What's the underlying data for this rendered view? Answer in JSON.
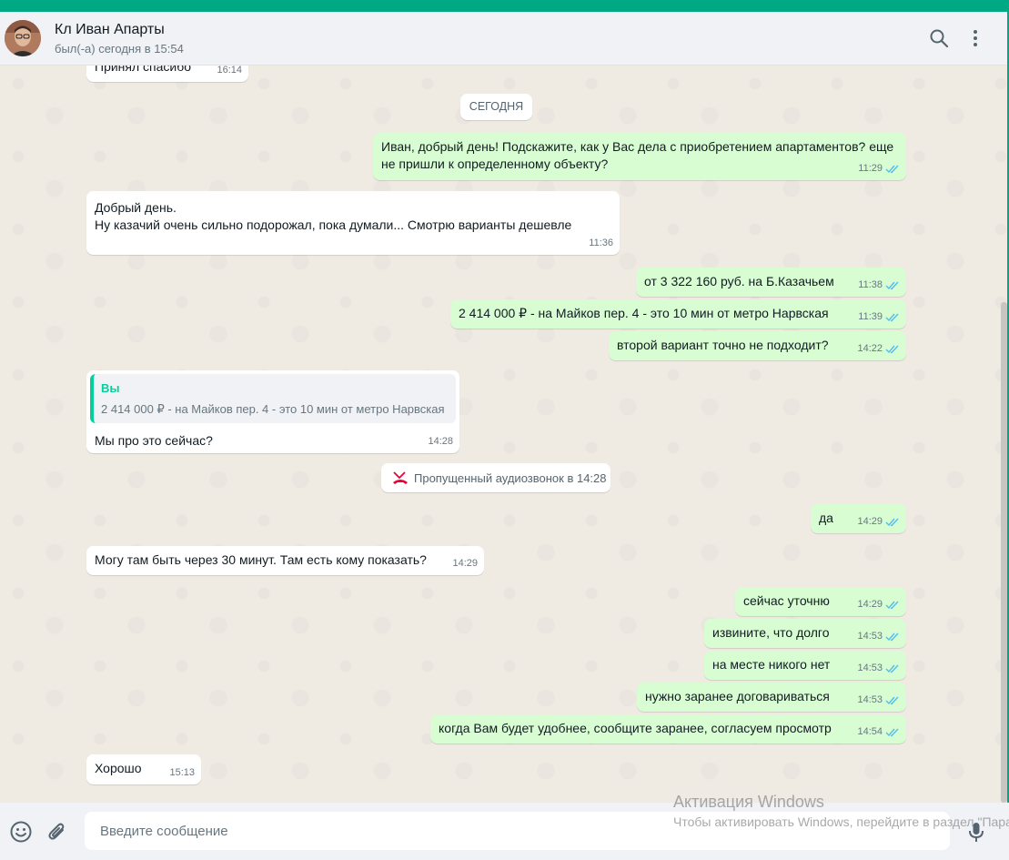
{
  "header": {
    "contact_name": "Кл Иван Апарты",
    "status": "был(-а) сегодня в 15:54"
  },
  "colors": {
    "accent": "#00a884",
    "outgoing_bubble": "#d9fdd3",
    "incoming_bubble": "#ffffff",
    "read_ticks": "#53bdeb",
    "missed_call": "#ea0038"
  },
  "chat": {
    "partial_message": {
      "text": "Принял спасибо",
      "time": "16:14"
    },
    "day_label": "СЕГОДНЯ",
    "messages": [
      {
        "dir": "out",
        "text": "Иван, добрый день! Подскажите, как у Вас дела с приобретением апартаментов? еще\nне пришли к определенному объекту?",
        "time": "11:29"
      },
      {
        "dir": "in",
        "text": "Добрый день.\nНу казачий очень сильно подорожал, пока думали... Смотрю варианты дешевле",
        "time": "11:36"
      },
      {
        "dir": "out",
        "text": "от 3 322 160 руб. на Б.Казачьем",
        "time": "11:38"
      },
      {
        "dir": "out",
        "text": "2 414 000 ₽ - на Майков пер. 4 - это 10 мин от метро Нарвская",
        "time": "11:39"
      },
      {
        "dir": "out",
        "text": "второй вариант точно не подходит?",
        "time": "14:22"
      },
      {
        "dir": "in",
        "quote_author": "Вы",
        "quote_text": "2 414 000 ₽ - на Майков пер. 4 - это 10 мин от метро Нарвская",
        "text": "Мы про это сейчас?",
        "time": "14:28"
      },
      {
        "dir": "out",
        "text": "да",
        "time": "14:29"
      },
      {
        "dir": "in",
        "text": "Могу там быть через 30 минут. Там есть кому показать?",
        "time": "14:29"
      },
      {
        "dir": "out",
        "text": "сейчас уточню",
        "time": "14:29"
      },
      {
        "dir": "out",
        "text": "извините, что долго",
        "time": "14:53"
      },
      {
        "dir": "out",
        "text": "на месте никого нет",
        "time": "14:53"
      },
      {
        "dir": "out",
        "text": "нужно заранее договариваться",
        "time": "14:53"
      },
      {
        "dir": "out",
        "text": "когда Вам будет удобнее, сообщите заранее, согласуем просмотр",
        "time": "14:54"
      },
      {
        "dir": "in",
        "text": "Хорошо",
        "time": "15:13"
      }
    ],
    "missed_call": "Пропущенный аудиозвонок в 14:28"
  },
  "footer": {
    "input_placeholder": "Введите сообщение"
  },
  "watermark": {
    "title": "Активация Windows",
    "subtitle": "Чтобы активировать Windows, перейдите в раздел \"Параметры\"."
  },
  "icons": [
    "search-icon",
    "menu-icon",
    "emoji-icon",
    "attach-icon",
    "mic-icon",
    "double-check-icon",
    "missed-call-icon"
  ]
}
